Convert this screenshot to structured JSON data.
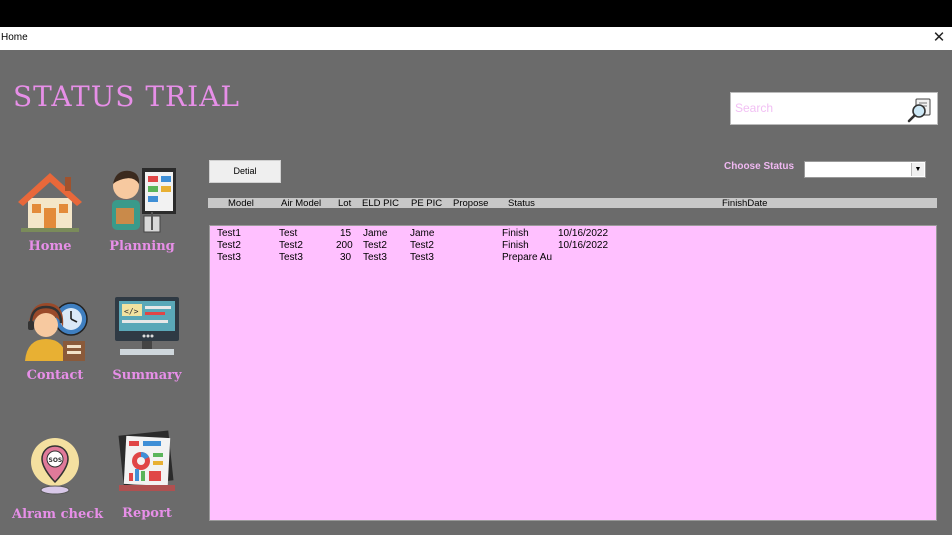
{
  "window": {
    "title": "Home",
    "close_glyph": "✕"
  },
  "app": {
    "title": "STATUS TRIAL"
  },
  "search": {
    "placeholder": "Search",
    "value": "",
    "icon": "search-icon"
  },
  "nav": {
    "home": {
      "label": "Home",
      "icon": "house-icon"
    },
    "planning": {
      "label": "Planning",
      "icon": "planner-icon"
    },
    "contact": {
      "label": "Contact",
      "icon": "support-agent-icon"
    },
    "summary": {
      "label": "Summary",
      "icon": "code-monitor-icon"
    },
    "alarm": {
      "label": "Alram check",
      "icon": "sos-alarm-icon"
    },
    "report": {
      "label": "Report",
      "icon": "report-board-icon"
    }
  },
  "toolbar": {
    "detail_label": "Detial"
  },
  "status_filter": {
    "label": "Choose Status",
    "value": ""
  },
  "table": {
    "columns": [
      "Model",
      "Air Model",
      "Lot",
      "ELD PIC",
      "PE PIC",
      "Propose",
      "Status",
      "FinishDate"
    ],
    "rows": [
      {
        "model": "Test1",
        "air_model": "Test",
        "lot": "15",
        "eld_pic": "Jame",
        "pe_pic": "Jame",
        "propose": "",
        "status": "Finish",
        "finish_date": "10/16/2022"
      },
      {
        "model": "Test2",
        "air_model": "Test2",
        "lot": "200",
        "eld_pic": "Test2",
        "pe_pic": "Test2",
        "propose": "",
        "status": "Finish",
        "finish_date": "10/16/2022"
      },
      {
        "model": "Test3",
        "air_model": "Test3",
        "lot": "30",
        "eld_pic": "Test3",
        "pe_pic": "Test3",
        "propose": "",
        "status": "Prepare Au",
        "finish_date": ""
      }
    ]
  },
  "colors": {
    "background": "#6b6b6b",
    "accent_pink": "#e78fe8",
    "list_bg": "#ffc0ff",
    "header_bg": "#c8c8c8"
  }
}
